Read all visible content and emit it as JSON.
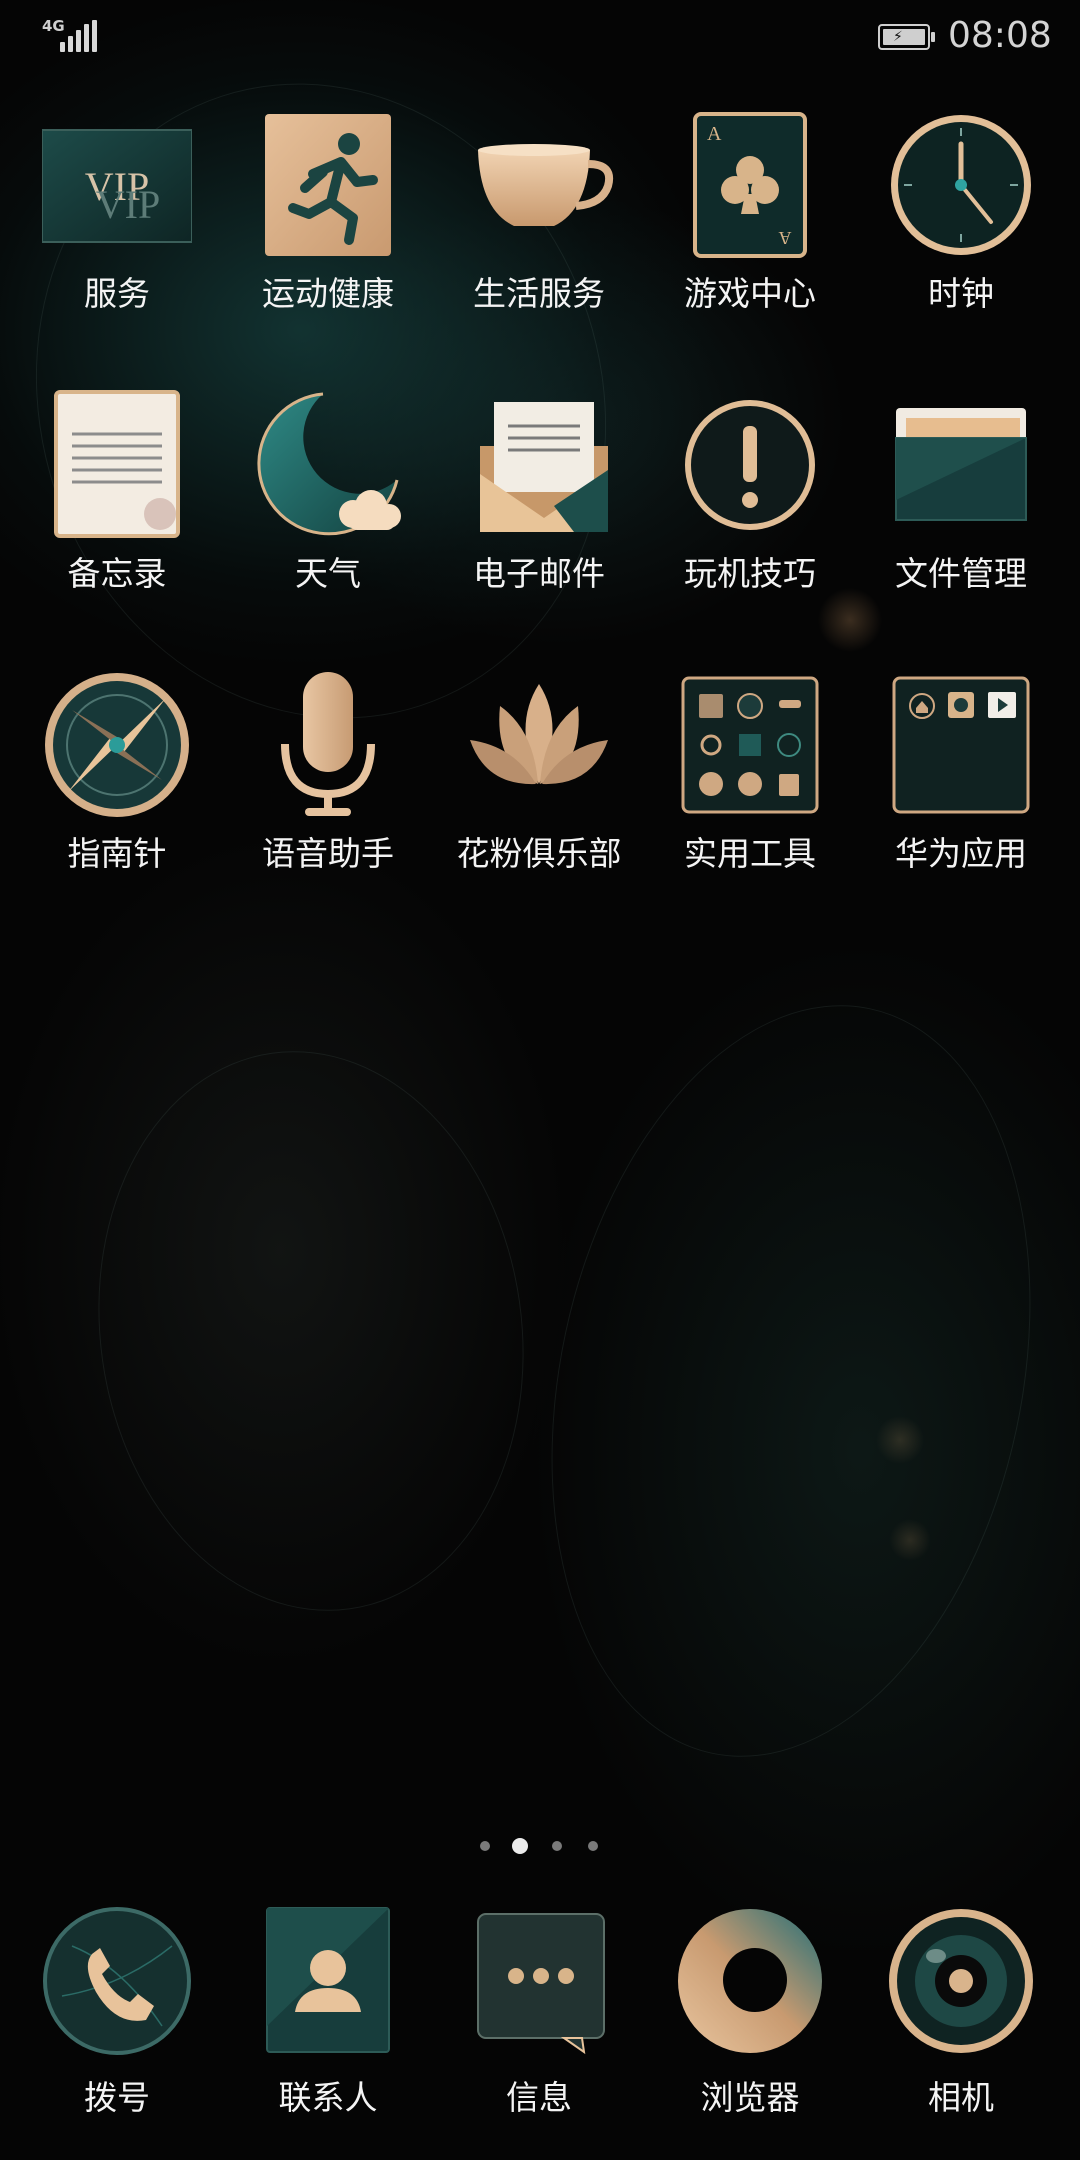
{
  "status_bar": {
    "network": "4G",
    "time": "08:08",
    "signal_icon": "signal-bars-icon",
    "battery_icon": "battery-charging-icon"
  },
  "home_apps": [
    {
      "label": "服务",
      "icon": "vip-icon"
    },
    {
      "label": "运动健康",
      "icon": "running-person-icon"
    },
    {
      "label": "生活服务",
      "icon": "cup-icon"
    },
    {
      "label": "游戏中心",
      "icon": "playing-card-icon"
    },
    {
      "label": "时钟",
      "icon": "clock-icon"
    },
    {
      "label": "备忘录",
      "icon": "notepad-icon"
    },
    {
      "label": "天气",
      "icon": "moon-cloud-icon"
    },
    {
      "label": "电子邮件",
      "icon": "envelope-icon"
    },
    {
      "label": "玩机技巧",
      "icon": "exclamation-icon"
    },
    {
      "label": "文件管理",
      "icon": "folder-icon"
    },
    {
      "label": "指南针",
      "icon": "compass-icon"
    },
    {
      "label": "语音助手",
      "icon": "microphone-icon"
    },
    {
      "label": "花粉俱乐部",
      "icon": "lotus-icon"
    },
    {
      "label": "实用工具",
      "icon": "tools-folder-icon"
    },
    {
      "label": "华为应用",
      "icon": "huawei-apps-folder-icon"
    }
  ],
  "vip_icon_text": "VIP",
  "card_icon_text": "A",
  "page_indicator": {
    "count": 4,
    "active": 2
  },
  "dock_apps": [
    {
      "label": "拨号",
      "icon": "phone-icon"
    },
    {
      "label": "联系人",
      "icon": "contact-icon"
    },
    {
      "label": "信息",
      "icon": "message-icon"
    },
    {
      "label": "浏览器",
      "icon": "browser-icon"
    },
    {
      "label": "相机",
      "icon": "camera-icon"
    }
  ],
  "colors": {
    "gold": "#dcb48a",
    "teal": "#173d3d",
    "label": "#f4f4f4",
    "background": "#050505"
  }
}
